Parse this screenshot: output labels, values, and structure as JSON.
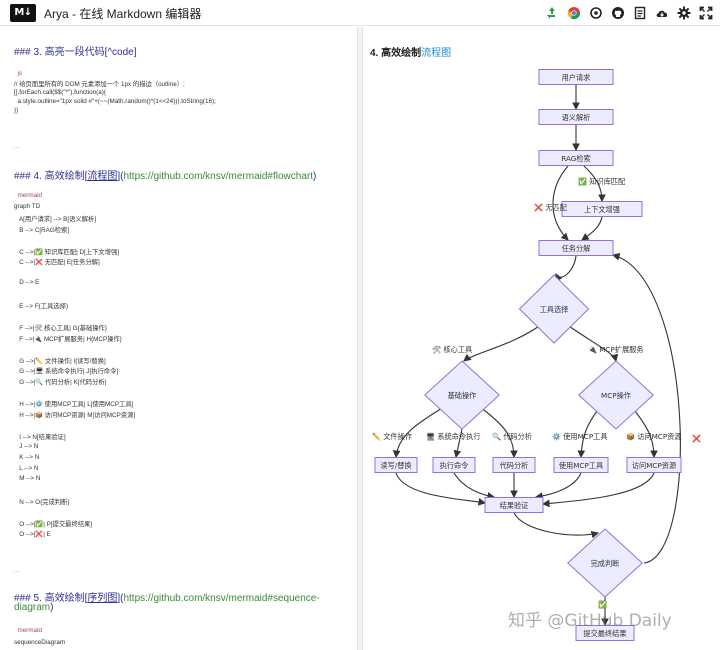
{
  "app": {
    "logo_text": "M↓",
    "title": "Arya - 在线 Markdown 编辑器",
    "toolbar_icons": [
      "recycle-icon",
      "chrome-icon",
      "gear-refresh-icon",
      "github-icon",
      "document-icon",
      "cloud-download-icon",
      "settings-icon",
      "fullscreen-icon"
    ]
  },
  "editor": {
    "h1": {
      "mark": "### 3. 高亮一段代码[^code]"
    },
    "code1": [
      "  js",
      "// 给页面里所有的 DOM 元素添加一个 1px 的描边（outline）;",
      "[].forEach.call($$(\"*\"),function(a){",
      "  a.style.outline=\"1px solid #\"+(~~(Math.random()*(1<<24))).toString(16);",
      "})"
    ],
    "sep1": "...",
    "h2": {
      "prefix": "### 4. 高效绘制[",
      "link": "流程图",
      "mid": "](",
      "url": "https://github.com/knsv/mermaid#flowchart",
      "suffix": ")"
    },
    "code2": [
      "  mermaid",
      "graph TD",
      "   A[用户请求] --> B[语义解析]",
      "   B --> C[RAG检索]",
      "",
      "   C -->|✅ 知识库匹配| D[上下文增强]",
      "   C -->|❌ 无匹配| E[任务分解]",
      "",
      "   D --> E",
      "",
      "   E --> F{工具选择}",
      "",
      "   F -->|🛠 核心工具| G{基础操作}",
      "   F -->|🔌 MCP扩展服务| H{MCP操作}",
      "",
      "   G -->|✏️ 文件操作| I[读写/替换]",
      "   G -->|🖥 系统命令执行| J[执行命令]",
      "   G -->|🔍 代码分析| K[代码分析]",
      "",
      "   H -->|⚙️ 使用MCP工具| L[使用MCP工具]",
      "   H -->|📦 访问MCP资源| M[访问MCP资源]",
      "",
      "   I --> N[结果验证]",
      "   J --> N",
      "   K --> N",
      "   L --> N",
      "   M --> N",
      "",
      "   N --> O{完成判断}",
      "",
      "   O -->|✅| P[提交最终结果]",
      "   O -->|❌| E"
    ],
    "sep2": "...",
    "h3": {
      "prefix": "### 5. 高效绘制[",
      "link": "序列图",
      "mid": "](",
      "url": "https://github.com/knsv/mermaid#sequence-",
      "url2": "diagram",
      "suffix": ")"
    },
    "code3": [
      "  mermaid",
      "sequenceDiagram"
    ]
  },
  "preview": {
    "heading_prefix": "4. 高效绘制",
    "heading_link": "流程图",
    "flow": {
      "nodes": {
        "A": "用户请求",
        "B": "语义解析",
        "C": "RAG检索",
        "D": "上下文增强",
        "E": "任务分解",
        "F": "工具选择",
        "G": "基础操作",
        "H": "MCP操作",
        "I": "读写/替换",
        "J": "执行命令",
        "K": "代码分析",
        "L": "使用MCP工具",
        "M": "访问MCP资源",
        "N": "结果验证",
        "O": "完成判断",
        "P": "提交最终结果"
      },
      "edge_labels": {
        "match": "✅ 知识库匹配",
        "nomatch": "❌ 无匹配",
        "core": "🛠 核心工具",
        "mcp": "🔌 MCP扩展服务",
        "file": "✏️ 文件操作",
        "cmd": "🖥 系统命令执行",
        "code": "🔍 代码分析",
        "usemcp": "⚙️ 使用MCP工具",
        "accmcp": "📦 访问MCP资源",
        "yes": "✅",
        "no": "❌"
      }
    },
    "watermark": "知乎 @GitHub Daily"
  }
}
